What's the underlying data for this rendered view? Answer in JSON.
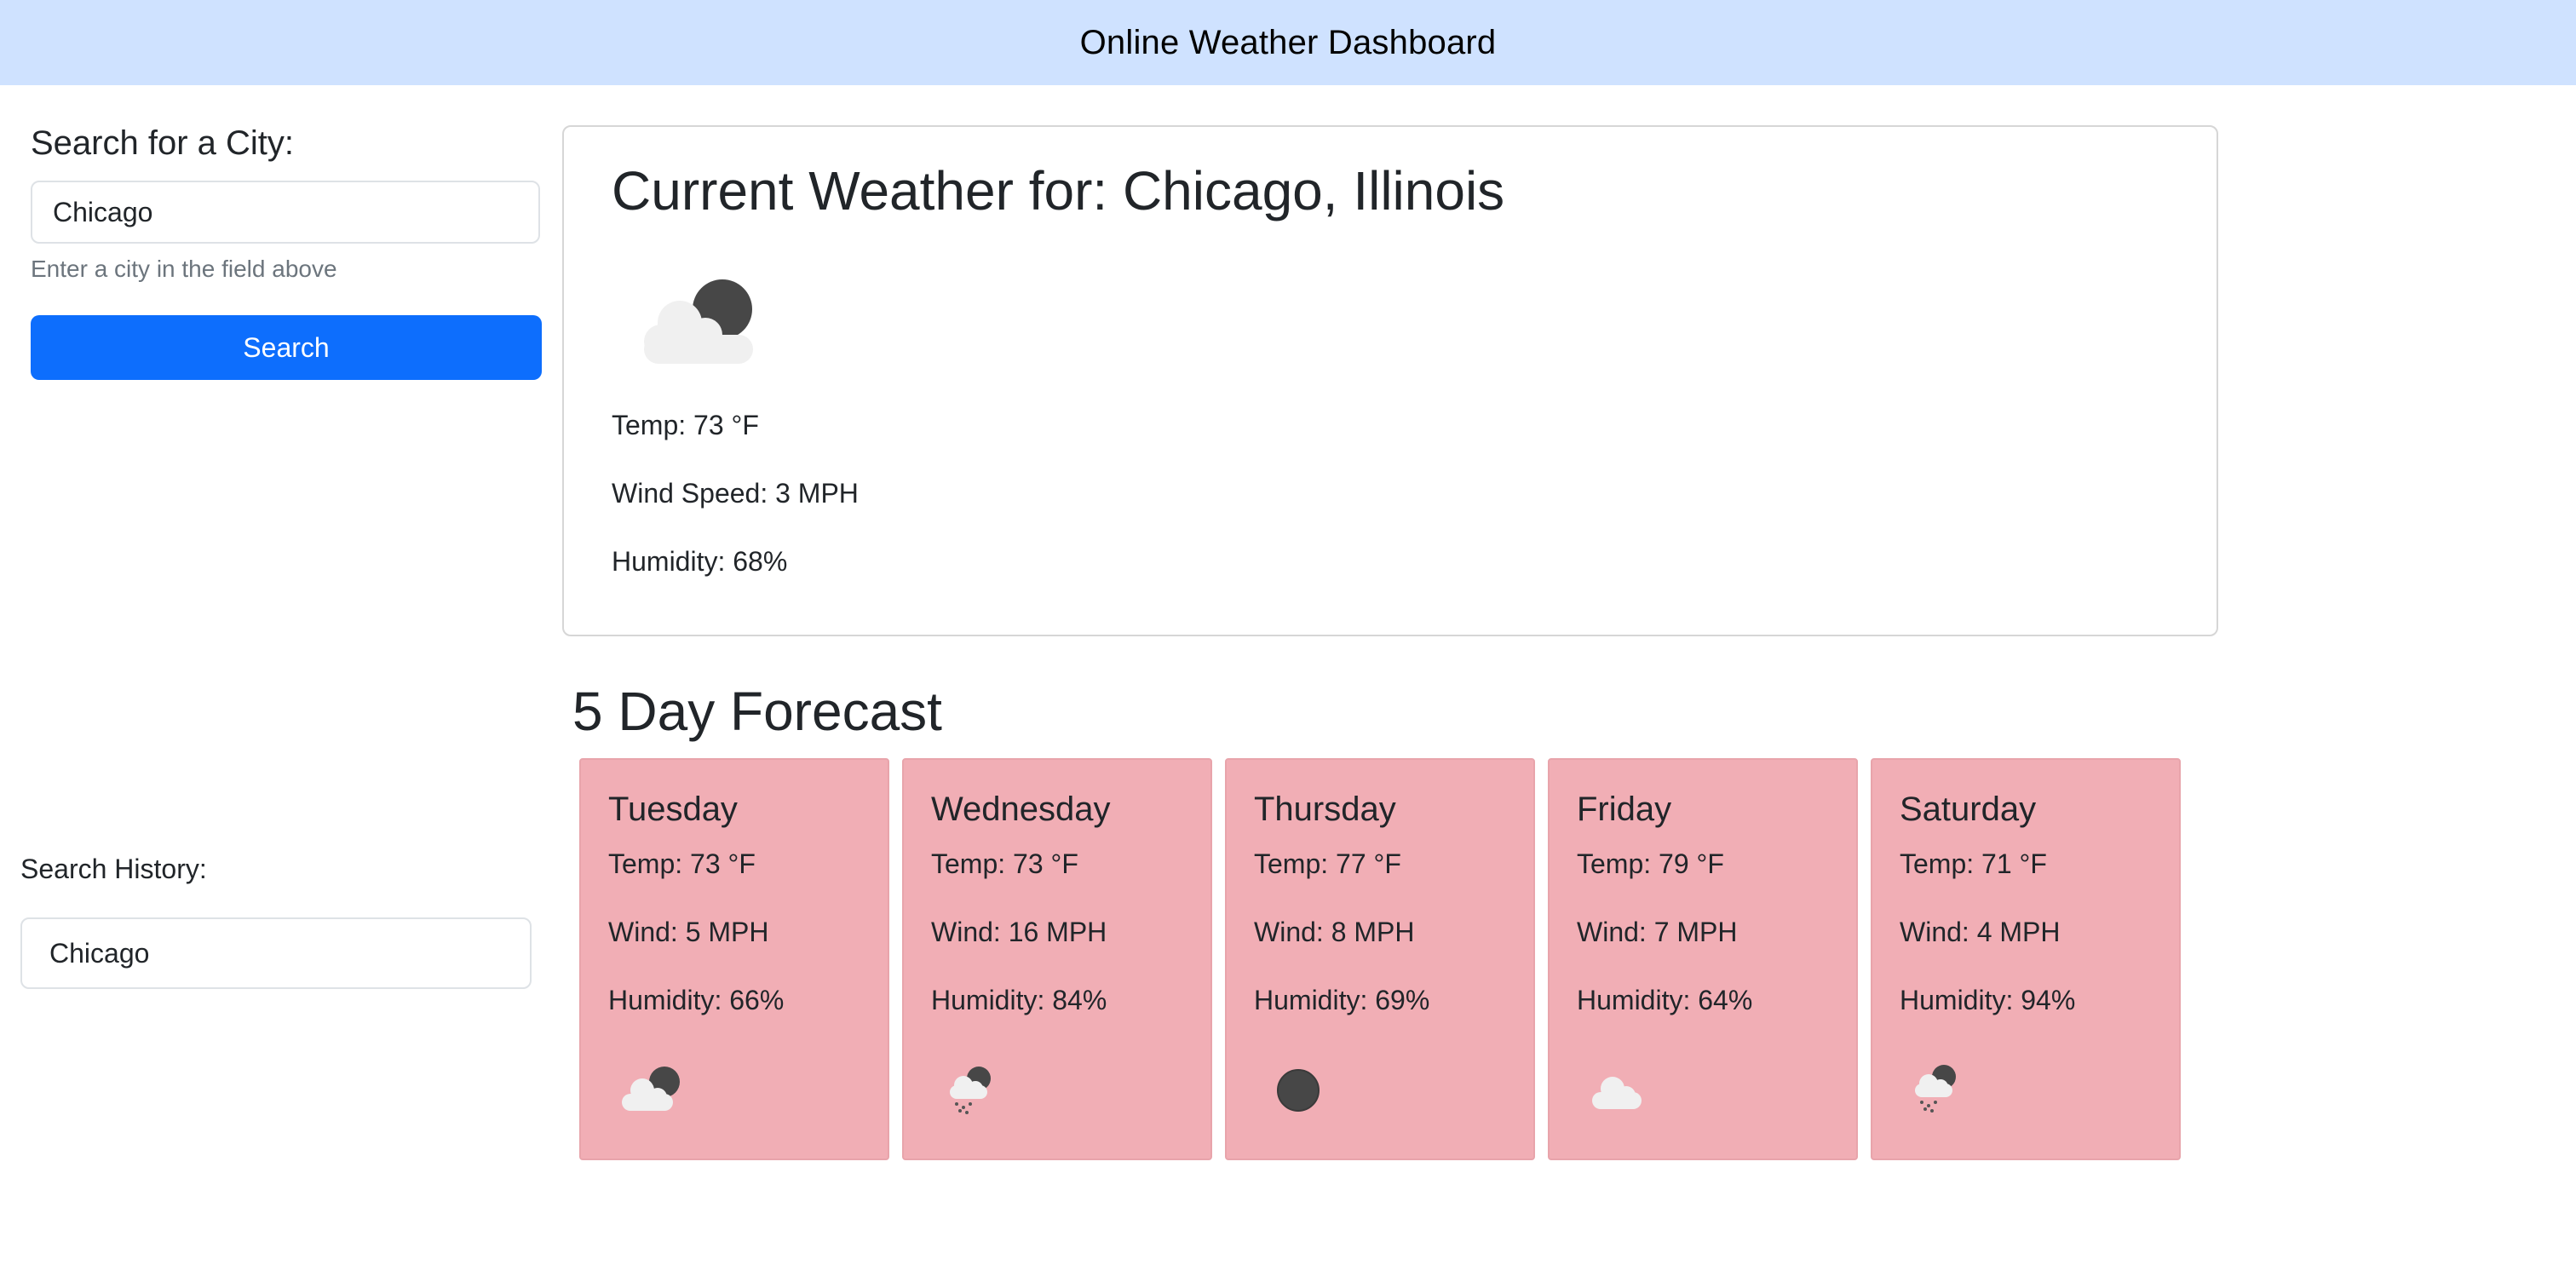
{
  "header": {
    "title": "Online Weather Dashboard"
  },
  "search": {
    "label": "Search for a City:",
    "value": "Chicago",
    "help_text": "Enter a city in the field above",
    "button_label": "Search"
  },
  "history": {
    "label": "Search History:",
    "items": [
      "Chicago"
    ]
  },
  "current": {
    "title": "Current Weather for: Chicago, Illinois",
    "icon": "partly-cloudy-night-icon",
    "temp": "Temp: 73 °F",
    "wind": "Wind Speed: 3 MPH",
    "humidity": "Humidity: 68%"
  },
  "forecast": {
    "title": "5 Day Forecast",
    "days": [
      {
        "day": "Tuesday",
        "temp": "Temp: 73 °F",
        "wind": "Wind: 5 MPH",
        "humidity": "Humidity: 66%",
        "icon": "partly-cloudy-night-icon"
      },
      {
        "day": "Wednesday",
        "temp": "Temp: 73 °F",
        "wind": "Wind: 16 MPH",
        "humidity": "Humidity: 84%",
        "icon": "rain-night-icon"
      },
      {
        "day": "Thursday",
        "temp": "Temp: 77 °F",
        "wind": "Wind: 8 MPH",
        "humidity": "Humidity: 69%",
        "icon": "clear-night-icon"
      },
      {
        "day": "Friday",
        "temp": "Temp: 79 °F",
        "wind": "Wind: 7 MPH",
        "humidity": "Humidity: 64%",
        "icon": "cloud-icon"
      },
      {
        "day": "Saturday",
        "temp": "Temp: 71 °F",
        "wind": "Wind: 4 MPH",
        "humidity": "Humidity: 94%",
        "icon": "rain-night-icon"
      }
    ]
  },
  "colors": {
    "navbar_bg": "#cfe2ff",
    "primary_button": "#0d6efd",
    "forecast_card_bg": "#f1aeb5"
  }
}
